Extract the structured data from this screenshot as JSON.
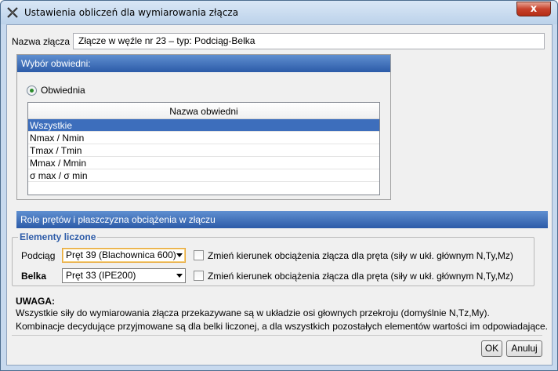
{
  "window": {
    "title": "Ustawienia obliczeń dla wymiarowania złącza",
    "close_label": "x"
  },
  "joint": {
    "name_label": "Nazwa złącza",
    "name_value": "Złącze w węźle nr 23 – typ: Podciąg-Belka"
  },
  "envelope": {
    "header": "Wybór obwiedni:",
    "radio_label": "Obwiednia",
    "table_header": "Nazwa obwiedni",
    "rows": [
      "Wszystkie",
      "Nmax / Nmin",
      "Tmax / Tmin",
      "Mmax / Mmin",
      "σ max / σ min"
    ]
  },
  "roles": {
    "header": "Role prętów i płaszczyzna obciążenia w złączu",
    "legend": "Elementy liczone",
    "items": [
      {
        "label": "Podciąg",
        "select": "Pręt 39 (Blachownica 600)",
        "checkbox_label": "Zmień kierunek obciążenia złącza dla pręta (siły w ukł. głównym N,Ty,Mz)"
      },
      {
        "label": "Belka",
        "select": "Pręt 33 (IPE200)",
        "checkbox_label": "Zmień kierunek obciążenia złącza dla pręta (siły w ukł. głównym N,Ty,Mz)"
      }
    ]
  },
  "note": {
    "title": "UWAGA:",
    "line1": "Wszystkie siły do wymiarowania złącza przekazywane są w układzie osi głownych przekroju (domyślnie N,Tz,My).",
    "line2": "Kombinacje decydujące przyjmowane są dla belki liczonej, a dla wszystkich pozostałych elementów wartości im odpowiadające."
  },
  "buttons": {
    "ok": "OK",
    "cancel": "Anuluj"
  }
}
